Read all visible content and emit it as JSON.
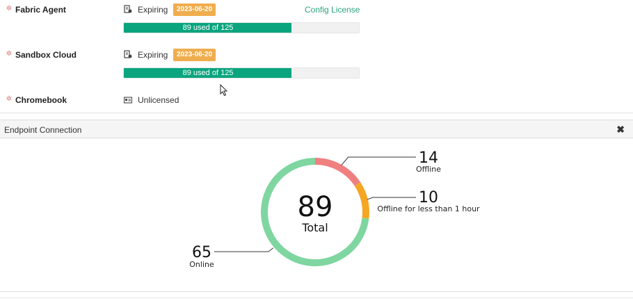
{
  "licenses": [
    {
      "name": "Fabric Agent",
      "status": "Expiring",
      "date": "2023-06-20",
      "usage_text": "89 used of 125",
      "used": 89,
      "total": 125,
      "action": "Config License"
    },
    {
      "name": "Sandbox Cloud",
      "status": "Expiring",
      "date": "2023-06-20",
      "usage_text": "89 used of 125",
      "used": 89,
      "total": 125
    },
    {
      "name": "Chromebook",
      "status": "Unlicensed"
    }
  ],
  "panel": {
    "title": "Endpoint Connection",
    "close_glyph": "✖"
  },
  "chart_data": {
    "type": "pie",
    "center_value": "89",
    "center_label": "Total",
    "slices": [
      {
        "label": "Offline",
        "value": 14,
        "color": "#f08080"
      },
      {
        "label": "Offline for less than 1 hour",
        "value": 10,
        "color": "#f5a623"
      },
      {
        "label": "Online",
        "value": 65,
        "color": "#7fd6a0"
      }
    ]
  },
  "colors": {
    "accent": "#0aa57e",
    "badge": "#f0ad4e",
    "link": "#2aa57e"
  },
  "icons": {
    "product": "bug-icon",
    "expiring": "license-expiring-icon",
    "unlicensed": "id-card-icon"
  }
}
